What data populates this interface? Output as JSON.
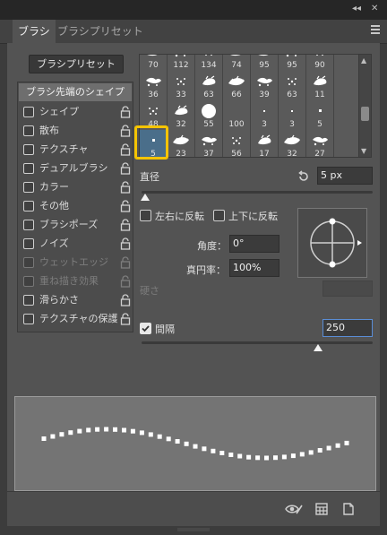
{
  "window_controls": {
    "collapse": "◂◂",
    "close": "✕"
  },
  "tabs": [
    {
      "label": "ブラシ",
      "active": true
    },
    {
      "label": "ブラシプリセット",
      "active": false
    }
  ],
  "brush_preset_button": "ブラシプリセット",
  "left_panel": {
    "header": "ブラシ先端のシェイプ",
    "options": [
      {
        "label": "シェイプ",
        "checked": false,
        "enabled": true
      },
      {
        "label": "散布",
        "checked": false,
        "enabled": true
      },
      {
        "label": "テクスチャ",
        "checked": false,
        "enabled": true
      },
      {
        "label": "デュアルブラシ",
        "checked": false,
        "enabled": true
      },
      {
        "label": "カラー",
        "checked": false,
        "enabled": true
      },
      {
        "label": "その他",
        "checked": false,
        "enabled": true
      },
      {
        "label": "ブラシポーズ",
        "checked": false,
        "enabled": true
      },
      {
        "label": "ノイズ",
        "checked": false,
        "enabled": true
      },
      {
        "label": "ウェットエッジ",
        "checked": false,
        "enabled": false
      },
      {
        "label": "重ね描き効果",
        "checked": false,
        "enabled": false
      },
      {
        "label": "滑らかさ",
        "checked": false,
        "enabled": true
      },
      {
        "label": "テクスチャの保護",
        "checked": false,
        "enabled": true
      }
    ]
  },
  "brush_grid": {
    "rows": [
      [
        "70",
        "112",
        "134",
        "74",
        "95",
        "95",
        "90",
        ""
      ],
      [
        "36",
        "33",
        "63",
        "66",
        "39",
        "63",
        "11",
        ""
      ],
      [
        "48",
        "32",
        "55",
        "100",
        "3",
        "3",
        "5",
        ""
      ],
      [
        "5",
        "23",
        "37",
        "56",
        "17",
        "32",
        "27",
        ""
      ]
    ],
    "selected_size": "5"
  },
  "size": {
    "label": "直径",
    "value": "5 px"
  },
  "flip_x": {
    "label": "左右に反転",
    "checked": false
  },
  "flip_y": {
    "label": "上下に反転",
    "checked": false
  },
  "angle": {
    "label": "角度：",
    "value": "0°"
  },
  "roundness": {
    "label": "真円率：",
    "value": "100%"
  },
  "hardness": {
    "label": "硬さ"
  },
  "spacing": {
    "label": "間隔",
    "checked": true,
    "value": "250"
  },
  "colors": {
    "accent_selected": "#f5c400",
    "panel_bg": "#535353",
    "preview_bg": "#747474"
  },
  "bottom_icons": [
    "eye-brush-icon",
    "grid-panel-icon",
    "new-brush-icon"
  ]
}
